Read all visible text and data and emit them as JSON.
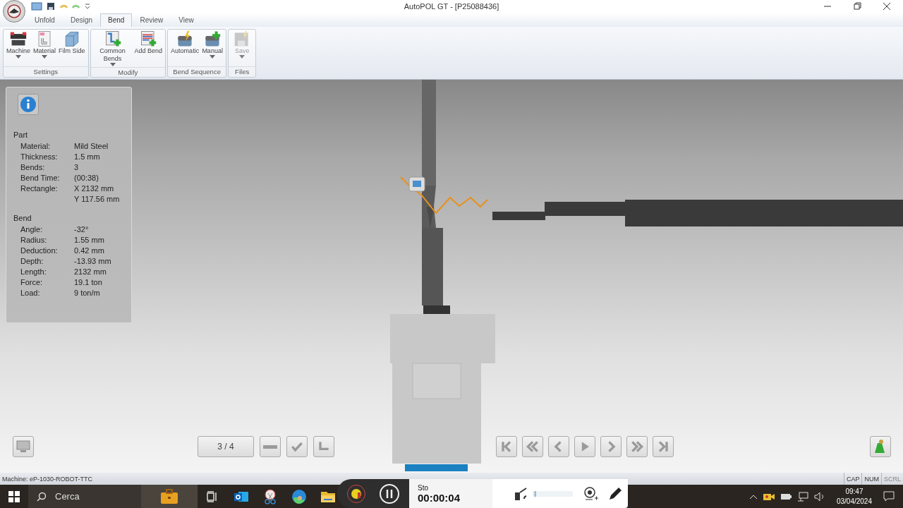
{
  "window": {
    "title": "AutoPOL GT - [P25088436]"
  },
  "tabs": [
    {
      "label": "Unfold",
      "selected": false
    },
    {
      "label": "Design",
      "selected": false
    },
    {
      "label": "Bend",
      "selected": true
    },
    {
      "label": "Review",
      "selected": false
    },
    {
      "label": "View",
      "selected": false
    }
  ],
  "ribbon": [
    {
      "group": "Settings",
      "buttons": [
        {
          "kind": "machine",
          "label": "Machine",
          "dropdown": true,
          "disabled": false
        },
        {
          "kind": "material",
          "label": "Material",
          "dropdown": true,
          "disabled": false
        },
        {
          "kind": "film",
          "label": "Film Side",
          "dropdown": false,
          "disabled": false
        }
      ]
    },
    {
      "group": "Modify",
      "buttons": [
        {
          "kind": "common",
          "label": "Common Bends",
          "dropdown": true,
          "disabled": false
        },
        {
          "kind": "add",
          "label": "Add Bend",
          "dropdown": false,
          "disabled": false
        }
      ]
    },
    {
      "group": "Bend Sequence",
      "buttons": [
        {
          "kind": "auto",
          "label": "Automatic",
          "dropdown": false,
          "disabled": false
        },
        {
          "kind": "manual",
          "label": "Manual",
          "dropdown": true,
          "disabled": false
        }
      ]
    },
    {
      "group": "Files",
      "buttons": [
        {
          "kind": "save",
          "label": "Save",
          "dropdown": true,
          "disabled": true
        }
      ]
    }
  ],
  "info": [
    {
      "title": "Part",
      "rows": [
        {
          "label": "Material:",
          "value": "Mild Steel"
        },
        {
          "label": "Thickness:",
          "value": "1.5 mm"
        },
        {
          "label": "Bends:",
          "value": "3"
        },
        {
          "label": "Bend Time:",
          "value": "(00:38)"
        },
        {
          "label": "Rectangle:",
          "value": "X 2132 mm"
        },
        {
          "value": "Y 117.56 mm"
        }
      ]
    },
    {
      "title": "Bend",
      "rows": [
        {
          "label": "Angle:",
          "value": "-32°"
        },
        {
          "label": "Radius:",
          "value": "1.55 mm"
        },
        {
          "label": "Deduction:",
          "value": "0.42 mm"
        },
        {
          "label": "Depth:",
          "value": "-13.93 mm"
        },
        {
          "label": "Length:",
          "value": "2132 mm"
        },
        {
          "label": "Force:",
          "value": "19.1 ton"
        },
        {
          "label": "Load:",
          "value": "9 ton/m"
        }
      ]
    }
  ],
  "step_counter": "3 / 4",
  "tool_buttons": [
    {
      "kind": "dash"
    },
    {
      "kind": "check"
    },
    {
      "kind": "corner"
    }
  ],
  "nav_buttons": [
    {
      "kind": "first"
    },
    {
      "kind": "fast-back"
    },
    {
      "kind": "back"
    },
    {
      "kind": "play"
    },
    {
      "kind": "forward"
    },
    {
      "kind": "fast-forward"
    },
    {
      "kind": "last"
    }
  ],
  "status_bar": {
    "machine": "Machine: eP-1030-ROBOT-TTC",
    "indicators": [
      {
        "label": "CAP",
        "on": true
      },
      {
        "label": "NUM",
        "on": true
      },
      {
        "label": "SCRL",
        "on": false
      }
    ]
  },
  "taskbar": {
    "search_placeholder": "Cerca",
    "apps": [
      {
        "kind": "briefcase"
      },
      {
        "kind": "taskview"
      },
      {
        "kind": "mail"
      },
      {
        "kind": "scissors"
      },
      {
        "kind": "browser"
      },
      {
        "kind": "folder"
      }
    ],
    "clock_time": "09:47",
    "clock_date": "03/04/2024"
  },
  "recorder": {
    "label": "Sto",
    "timer": "00:00:04",
    "volume": {
      "level": 0.04
    }
  }
}
